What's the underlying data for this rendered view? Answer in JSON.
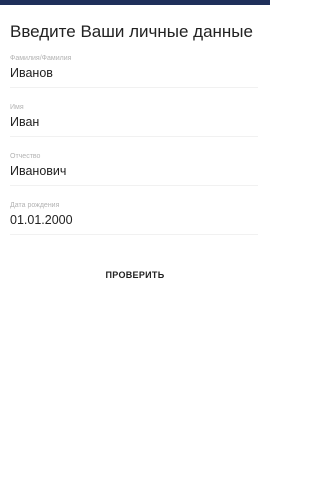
{
  "form": {
    "title": "Введите Ваши личные данные",
    "fields": [
      {
        "label": "Фамилия/Фамилия",
        "value": "Иванов"
      },
      {
        "label": "Имя",
        "value": "Иван"
      },
      {
        "label": "Отчество",
        "value": "Иванович"
      },
      {
        "label": "Дата рождения",
        "value": "01.01.2000"
      }
    ],
    "check_button_label": "ПРОВЕРИТЬ"
  },
  "colors": {
    "status_bar": "#1f2f5a",
    "text": "#222222",
    "label": "#b3b3b3",
    "background": "#ffffff"
  }
}
